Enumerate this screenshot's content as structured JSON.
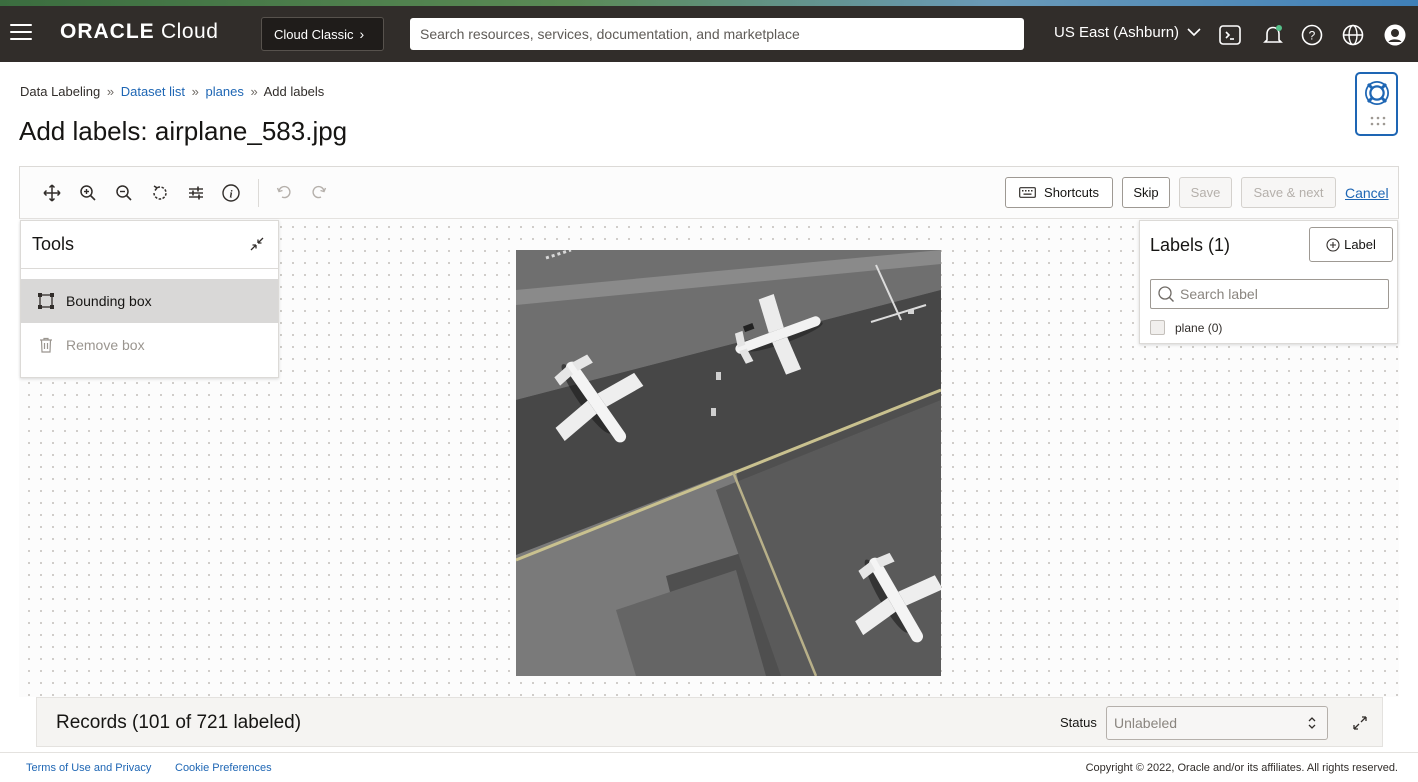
{
  "header": {
    "logo_brand": "ORACLE",
    "logo_product": "Cloud",
    "classic_label": "Cloud Classic",
    "search_placeholder": "Search resources, services, documentation, and marketplace",
    "region": "US East (Ashburn)",
    "icons": [
      "cloud-shell-icon",
      "notification-bell-icon",
      "help-icon",
      "language-globe-icon",
      "user-profile-icon"
    ]
  },
  "breadcrumb": {
    "root": "Data Labeling",
    "separator": "»",
    "dataset_list": "Dataset list",
    "dataset": "planes",
    "current": "Add labels"
  },
  "page_title": "Add labels: airplane_583.jpg",
  "toolbar": {
    "icons": [
      "move-icon",
      "zoom-in-icon",
      "zoom-out-icon",
      "reset-rotate-icon",
      "adjust-sliders-icon",
      "info-icon",
      "undo-icon",
      "redo-icon"
    ],
    "shortcuts_label": "Shortcuts",
    "skip_label": "Skip",
    "save_label": "Save",
    "save_next_label": "Save & next",
    "cancel_label": "Cancel"
  },
  "tools_panel": {
    "title": "Tools",
    "items": [
      {
        "label": "Bounding box",
        "icon": "bounding-box-icon",
        "active": true
      },
      {
        "label": "Remove box",
        "icon": "trash-icon",
        "active": false
      }
    ]
  },
  "labels_panel": {
    "title": "Labels (1)",
    "add_label": "Label",
    "search_placeholder": "Search label",
    "items": [
      {
        "label": "plane (0)",
        "checked": false
      }
    ]
  },
  "records": {
    "title": "Records (101 of 721 labeled)",
    "status_label": "Status",
    "status_value": "Unlabeled"
  },
  "footer": {
    "terms": "Terms of Use and Privacy",
    "cookies": "Cookie Preferences",
    "copyright": "Copyright © 2022, Oracle and/or its affiliates. All rights reserved."
  },
  "colors": {
    "header_bg": "#312d2a",
    "link": "#1e66b4",
    "help_widget_border": "#1e66b4"
  }
}
